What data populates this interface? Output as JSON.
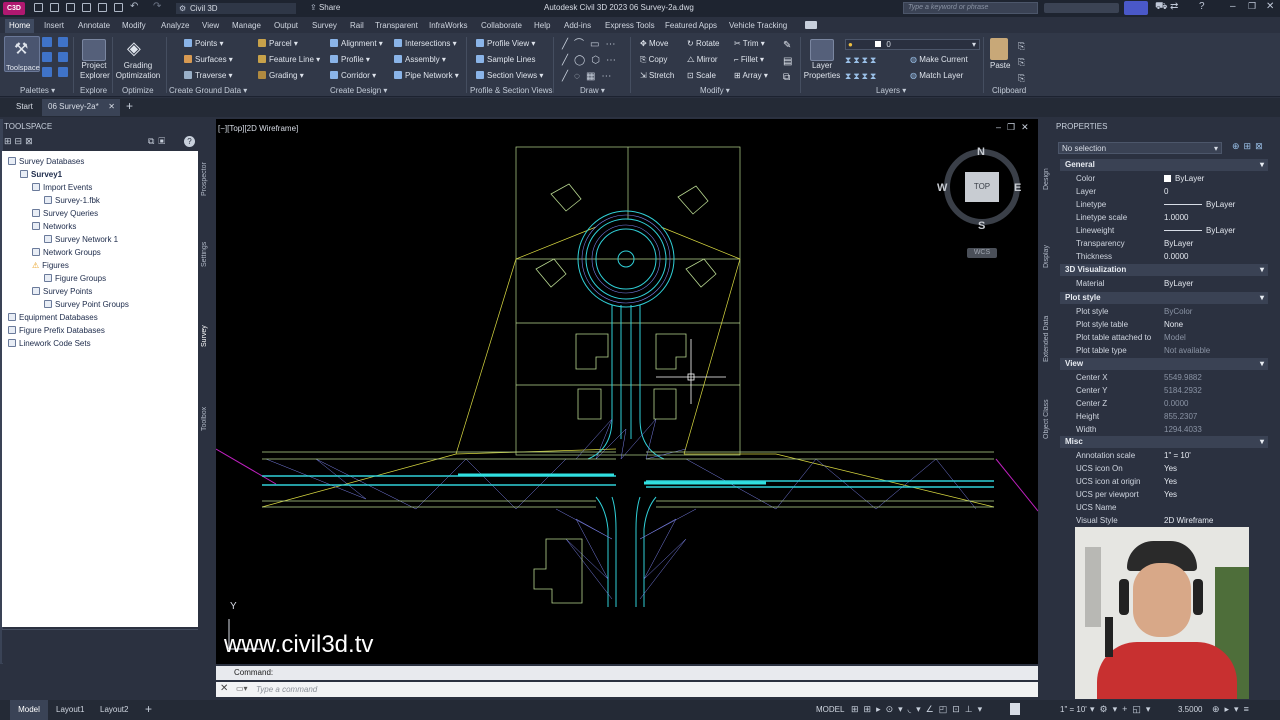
{
  "app": {
    "title": "Autodesk Civil 3D 2023   06 Survey-2a.dwg",
    "workspace": "Civil 3D",
    "share": "Share",
    "search_placeholder": "Type a keyword or phrase",
    "logo": "C3D"
  },
  "menu": [
    "Home",
    "Insert",
    "Annotate",
    "Modify",
    "Analyze",
    "View",
    "Manage",
    "Output",
    "Survey",
    "Rail",
    "Transparent",
    "InfraWorks",
    "Collaborate",
    "Help",
    "Add-ins",
    "Express Tools",
    "Featured Apps",
    "Vehicle Tracking"
  ],
  "ribbon": {
    "toolspace": "Toolspace",
    "project_explorer": "Project Explorer",
    "grading_optimization": "Grading Optimization",
    "col1": [
      "Points",
      "Surfaces",
      "Traverse"
    ],
    "col2": [
      "Parcel",
      "Feature Line",
      "Grading"
    ],
    "col3": [
      "Alignment",
      "Profile",
      "Corridor"
    ],
    "col4": [
      "Intersections",
      "Assembly",
      "Pipe Network"
    ],
    "col5": [
      "Profile View",
      "Sample Lines",
      "Section Views"
    ],
    "modify1": [
      "Move",
      "Copy",
      "Stretch"
    ],
    "modify2": [
      "Rotate",
      "Mirror",
      "Scale"
    ],
    "modify3": [
      "Trim",
      "Fillet",
      "Array"
    ],
    "layer_properties": "Layer Properties",
    "layer_value": "0",
    "make_current": "Make Current",
    "match_layer": "Match Layer",
    "paste": "Paste",
    "panels": [
      "Palettes",
      "Explore",
      "Optimize",
      "Create Ground Data",
      "Create Design",
      "Profile & Section Views",
      "Draw",
      "Modify",
      "Layers",
      "Clipboard"
    ]
  },
  "doctabs": {
    "start": "Start",
    "active": "06 Survey-2a*"
  },
  "toolspace": {
    "title": "TOOLSPACE",
    "tree": [
      "Survey Databases",
      "Survey1",
      "Import Events",
      "Survey-1.fbk",
      "Survey Queries",
      "Networks",
      "Survey Network 1",
      "Network Groups",
      "Figures",
      "Figure Groups",
      "Survey Points",
      "Survey Point Groups",
      "Equipment Databases",
      "Figure Prefix Databases",
      "Linework Code Sets"
    ],
    "vtabs": [
      "Prospector",
      "Settings",
      "Survey",
      "Toolbox"
    ]
  },
  "viewport": {
    "label": "[−][Top][2D Wireframe]",
    "compass": {
      "n": "N",
      "s": "S",
      "e": "E",
      "w": "W",
      "top": "TOP",
      "wcs": "WCS"
    },
    "watermark": "www.civil3d.tv",
    "ucs_y": "Y"
  },
  "command": {
    "label": "Command:",
    "placeholder": "Type a command"
  },
  "properties": {
    "title": "PROPERTIES",
    "selection": "No selection",
    "vtabs": [
      "Design",
      "Display",
      "Extended Data",
      "Object Class"
    ],
    "general": {
      "title": "General",
      "rows": [
        [
          "Color",
          "ByLayer"
        ],
        [
          "Layer",
          "0"
        ],
        [
          "Linetype",
          "ByLayer"
        ],
        [
          "Linetype scale",
          "1.0000"
        ],
        [
          "Lineweight",
          "ByLayer"
        ],
        [
          "Transparency",
          "ByLayer"
        ],
        [
          "Thickness",
          "0.0000"
        ]
      ]
    },
    "viz": {
      "title": "3D Visualization",
      "rows": [
        [
          "Material",
          "ByLayer"
        ]
      ]
    },
    "plot": {
      "title": "Plot style",
      "rows": [
        [
          "Plot style",
          "ByColor"
        ],
        [
          "Plot style table",
          "None"
        ],
        [
          "Plot table attached to",
          "Model"
        ],
        [
          "Plot table type",
          "Not available"
        ]
      ]
    },
    "view": {
      "title": "View",
      "rows": [
        [
          "Center X",
          "5549.9882"
        ],
        [
          "Center Y",
          "5184.2932"
        ],
        [
          "Center Z",
          "0.0000"
        ],
        [
          "Height",
          "855.2307"
        ],
        [
          "Width",
          "1294.4033"
        ]
      ]
    },
    "misc": {
      "title": "Misc",
      "rows": [
        [
          "Annotation scale",
          "1\" = 10'"
        ],
        [
          "UCS icon On",
          "Yes"
        ],
        [
          "UCS icon at origin",
          "Yes"
        ],
        [
          "UCS per viewport",
          "Yes"
        ],
        [
          "UCS Name",
          ""
        ],
        [
          "Visual Style",
          "2D Wireframe"
        ]
      ]
    }
  },
  "status": {
    "tabs": [
      "Model",
      "Layout1",
      "Layout2"
    ],
    "model": "MODEL",
    "scale": "1\" = 10'",
    "value": "3.5000"
  },
  "colors": {
    "accent": "#b01870",
    "bg": "#2b3140",
    "viewport": "#000000"
  }
}
